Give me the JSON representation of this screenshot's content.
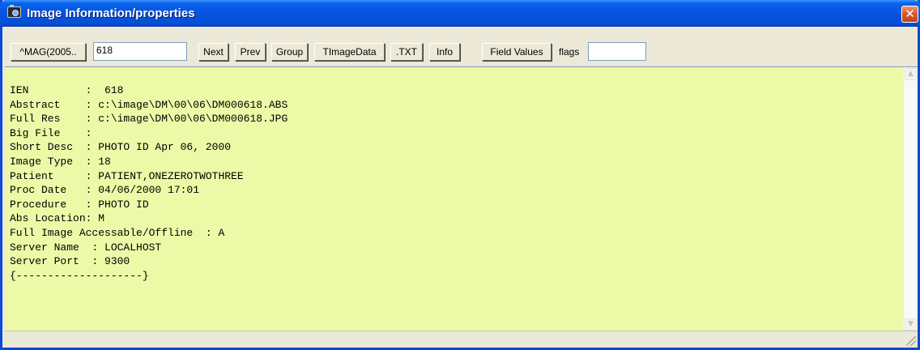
{
  "window": {
    "title": "Image Information/properties",
    "close_glyph": "✕"
  },
  "toolbar": {
    "mag_button": "^MAG(2005..",
    "ien_value": "618",
    "next_button": "Next",
    "prev_button": "Prev",
    "group_button": "Group",
    "timagedata_button": "TImageData",
    "txt_button": ".TXT",
    "info_button": "Info",
    "field_values_button": "Field Values",
    "flags_label": "flags",
    "flags_value": ""
  },
  "memo": {
    "background_color": "#ecfaa7",
    "lines": [
      "IEN         :  618",
      "Abstract    : c:\\image\\DM\\00\\06\\DM000618.ABS",
      "Full Res    : c:\\image\\DM\\00\\06\\DM000618.JPG",
      "Big File    :",
      "Short Desc  : PHOTO ID Apr 06, 2000",
      "Image Type  : 18",
      "Patient     : PATIENT,ONEZEROTWOTHREE",
      "Proc Date   : 04/06/2000 17:01",
      "Procedure   : PHOTO ID",
      "Abs Location: M",
      "Full Image Accessable/Offline  : A",
      "Server Name  : LOCALHOST",
      "Server Port  : 9300",
      "{--------------------}"
    ]
  },
  "scrollbar": {
    "up_glyph": "▲",
    "down_glyph": "▼"
  },
  "icons": {
    "title_icon": "camera-icon",
    "close_icon": "close-icon",
    "resize_icon": "resize-grip-icon"
  }
}
